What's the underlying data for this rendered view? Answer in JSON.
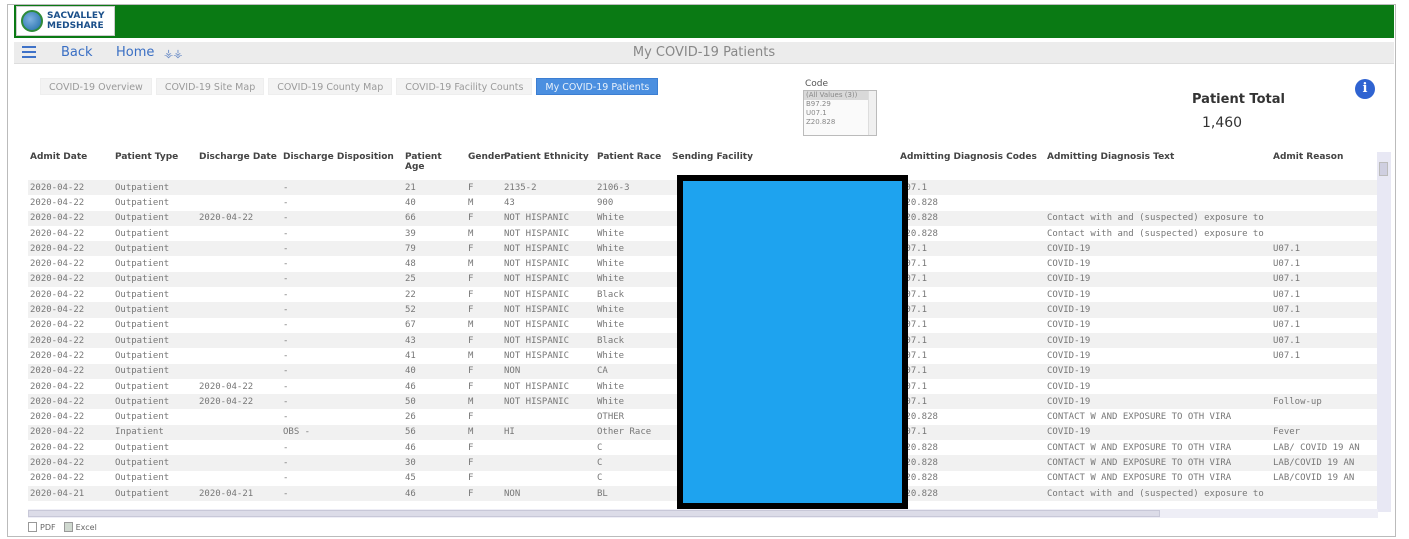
{
  "brand": {
    "line1": "SACVALLEY",
    "line2": "MEDSHARE"
  },
  "nav": {
    "back": "Back",
    "home": "Home",
    "home_icon": "⚶⚶",
    "title": "My COVID-19 Patients"
  },
  "tabs": [
    {
      "label": "COVID-19 Overview"
    },
    {
      "label": "COVID-19 Site Map"
    },
    {
      "label": "COVID-19 County Map"
    },
    {
      "label": "COVID-19 Facility Counts"
    },
    {
      "label": "My COVID-19 Patients"
    }
  ],
  "code_filter": {
    "label": "Code",
    "options": [
      "(All Values (3))",
      "B97.29",
      "U07.1",
      "Z20.828"
    ]
  },
  "total": {
    "label": "Patient Total",
    "value": "1,460"
  },
  "table": {
    "columns": [
      "Admit Date",
      "Patient Type",
      "Discharge Date",
      "Discharge Disposition",
      "Patient Age",
      "Gender",
      "Patient Ethnicity",
      "Patient Race",
      "Sending Facility",
      "Admitting Diagnosis Codes",
      "Admitting Diagnosis Text",
      "Admit Reason"
    ],
    "rows": [
      [
        "2020-04-22",
        "Outpatient",
        "",
        "-",
        "21",
        "F",
        "2135-2",
        "2106-3",
        "",
        "U07.1",
        "",
        ""
      ],
      [
        "2020-04-22",
        "Outpatient",
        "",
        "-",
        "40",
        "M",
        "43",
        "900",
        "",
        "Z20.828",
        "",
        ""
      ],
      [
        "2020-04-22",
        "Outpatient",
        "2020-04-22",
        "-",
        "66",
        "F",
        "NOT HISPANIC",
        "White",
        "",
        "Z20.828",
        "Contact with and (suspected) exposure to",
        ""
      ],
      [
        "2020-04-22",
        "Outpatient",
        "",
        "-",
        "39",
        "M",
        "NOT HISPANIC",
        "White",
        "",
        "Z20.828",
        "Contact with and (suspected) exposure to",
        ""
      ],
      [
        "2020-04-22",
        "Outpatient",
        "",
        "-",
        "79",
        "F",
        "NOT HISPANIC",
        "White",
        "",
        "U07.1",
        "COVID-19",
        "U07.1"
      ],
      [
        "2020-04-22",
        "Outpatient",
        "",
        "-",
        "48",
        "M",
        "NOT HISPANIC",
        "White",
        "",
        "U07.1",
        "COVID-19",
        "U07.1"
      ],
      [
        "2020-04-22",
        "Outpatient",
        "",
        "-",
        "25",
        "F",
        "NOT HISPANIC",
        "White",
        "",
        "U07.1",
        "COVID-19",
        "U07.1"
      ],
      [
        "2020-04-22",
        "Outpatient",
        "",
        "-",
        "22",
        "F",
        "NOT HISPANIC",
        "Black",
        "",
        "U07.1",
        "COVID-19",
        "U07.1"
      ],
      [
        "2020-04-22",
        "Outpatient",
        "",
        "-",
        "52",
        "F",
        "NOT HISPANIC",
        "White",
        "",
        "U07.1",
        "COVID-19",
        "U07.1"
      ],
      [
        "2020-04-22",
        "Outpatient",
        "",
        "-",
        "67",
        "M",
        "NOT HISPANIC",
        "White",
        "",
        "U07.1",
        "COVID-19",
        "U07.1"
      ],
      [
        "2020-04-22",
        "Outpatient",
        "",
        "-",
        "43",
        "F",
        "NOT HISPANIC",
        "Black",
        "",
        "U07.1",
        "COVID-19",
        "U07.1"
      ],
      [
        "2020-04-22",
        "Outpatient",
        "",
        "-",
        "41",
        "M",
        "NOT HISPANIC",
        "White",
        "",
        "U07.1",
        "COVID-19",
        "U07.1"
      ],
      [
        "2020-04-22",
        "Outpatient",
        "",
        "-",
        "40",
        "F",
        "NON",
        "CA",
        "",
        "U07.1",
        "COVID-19",
        ""
      ],
      [
        "2020-04-22",
        "Outpatient",
        "2020-04-22",
        "-",
        "46",
        "F",
        "NOT HISPANIC",
        "White",
        "",
        "U07.1",
        "COVID-19",
        ""
      ],
      [
        "2020-04-22",
        "Outpatient",
        "2020-04-22",
        "-",
        "50",
        "M",
        "NOT HISPANIC",
        "White",
        "",
        "U07.1",
        "COVID-19",
        "Follow-up"
      ],
      [
        "2020-04-22",
        "Outpatient",
        "",
        "-",
        "26",
        "F",
        "",
        "OTHER",
        "",
        "Z20.828",
        "CONTACT W AND EXPOSURE TO OTH VIRA",
        ""
      ],
      [
        "2020-04-22",
        "Inpatient",
        "",
        "OBS -",
        "56",
        "M",
        "HI",
        "Other Race",
        "",
        "U07.1",
        "COVID-19",
        "Fever"
      ],
      [
        "2020-04-22",
        "Outpatient",
        "",
        "-",
        "46",
        "F",
        "",
        "C",
        "",
        "Z20.828",
        "CONTACT W AND EXPOSURE TO OTH VIRA",
        "LAB/ COVID 19 AN"
      ],
      [
        "2020-04-22",
        "Outpatient",
        "",
        "-",
        "30",
        "F",
        "",
        "C",
        "",
        "Z20.828",
        "CONTACT W AND EXPOSURE TO OTH VIRA",
        "LAB/COVID 19 AN"
      ],
      [
        "2020-04-22",
        "Outpatient",
        "",
        "-",
        "45",
        "F",
        "",
        "C",
        "",
        "Z20.828",
        "CONTACT W AND EXPOSURE TO OTH VIRA",
        "LAB/COVID 19 AN"
      ],
      [
        "2020-04-21",
        "Outpatient",
        "2020-04-21",
        "-",
        "46",
        "F",
        "NON",
        "BL",
        "",
        "Z20.828",
        "Contact with and (suspected) exposure to",
        ""
      ]
    ]
  },
  "export": {
    "pdf": "PDF",
    "excel": "Excel"
  },
  "colors": {
    "brand_green": "#0a7a14",
    "active_tab": "#4b8fe0",
    "redaction": "#1ea3ef",
    "info": "#2f63d1"
  }
}
